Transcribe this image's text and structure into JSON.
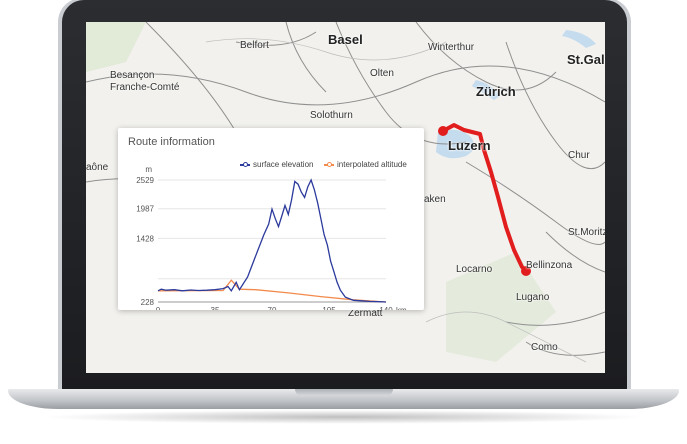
{
  "map": {
    "cities": [
      {
        "name": "Belfort",
        "big": false
      },
      {
        "name": "Basel",
        "big": true
      },
      {
        "name": "Winterthur",
        "big": false
      },
      {
        "name": "St.Gall",
        "big": true
      },
      {
        "name": "Besançon",
        "big": false
      },
      {
        "name": "Franche-Comté",
        "big": false
      },
      {
        "name": "Olten",
        "big": false
      },
      {
        "name": "Zürich",
        "big": true
      },
      {
        "name": "Solothurn",
        "big": false
      },
      {
        "name": "Luzern",
        "big": true
      },
      {
        "name": "Chur",
        "big": false
      },
      {
        "name": "aône",
        "big": false
      },
      {
        "name": "aken",
        "big": false
      },
      {
        "name": "St.Moritz",
        "big": false
      },
      {
        "name": "Locarno",
        "big": false
      },
      {
        "name": "Bellinzona",
        "big": false
      },
      {
        "name": "Lugano",
        "big": false
      },
      {
        "name": "Como",
        "big": false
      },
      {
        "name": "Zermatt",
        "big": false
      }
    ],
    "route_color": "#e11d1d"
  },
  "route_card": {
    "title": "Route information",
    "legend": [
      {
        "label": "surface elevation",
        "color": "#2b3a9c"
      },
      {
        "label": "interpolated altitude",
        "color": "#f28a4b"
      }
    ]
  },
  "chart_data": {
    "type": "line",
    "title": "",
    "ylabel": "m",
    "xlabel": "km",
    "yticks": [
      228,
      667,
      1428,
      1987,
      2529
    ],
    "ytick_labels": [
      "228",
      "",
      "1428",
      "1987",
      "2529"
    ],
    "xticks": [
      0,
      35,
      70,
      105,
      140
    ],
    "xlim": [
      0,
      140
    ],
    "ylim": [
      228,
      2529
    ],
    "series": [
      {
        "name": "surface elevation",
        "color": "#2b3a9c",
        "x": [
          0,
          2,
          5,
          10,
          15,
          20,
          25,
          30,
          35,
          40,
          43,
          45,
          48,
          50,
          55,
          60,
          65,
          68,
          70,
          72,
          74,
          76,
          78,
          80,
          82,
          84,
          86,
          88,
          90,
          92,
          94,
          96,
          98,
          100,
          102,
          104,
          106,
          108,
          110,
          112,
          115,
          120,
          125,
          130,
          135,
          140
        ],
        "y": [
          440,
          470,
          450,
          460,
          440,
          455,
          445,
          450,
          460,
          480,
          520,
          440,
          600,
          460,
          700,
          1100,
          1500,
          1700,
          1980,
          1800,
          1650,
          1850,
          2050,
          1880,
          2150,
          2500,
          2450,
          2300,
          2200,
          2400,
          2529,
          2350,
          2100,
          1800,
          1500,
          1300,
          1000,
          800,
          600,
          450,
          320,
          260,
          250,
          240,
          235,
          228
        ]
      },
      {
        "name": "interpolated altitude",
        "color": "#f28a4b",
        "x": [
          0,
          40,
          45,
          50,
          60,
          80,
          100,
          120,
          140
        ],
        "y": [
          440,
          445,
          640,
          470,
          460,
          400,
          330,
          270,
          228
        ]
      }
    ]
  }
}
